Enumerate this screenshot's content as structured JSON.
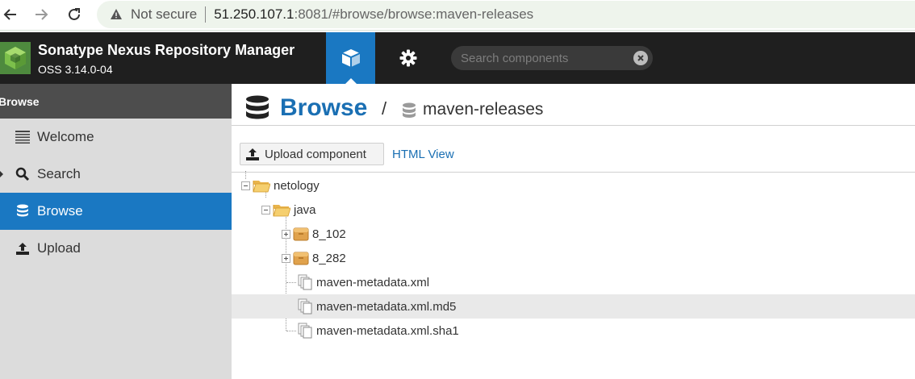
{
  "browser": {
    "security_label": "Not secure",
    "url_host": "51.250.107.1",
    "url_rest": ":8081/#browse/browse:maven-releases"
  },
  "header": {
    "app_title": "Sonatype Nexus Repository Manager",
    "version": "OSS 3.14.0-04",
    "search_placeholder": "Search components",
    "accent_color": "#1a78c2"
  },
  "sidebar": {
    "heading": "Browse",
    "items": [
      {
        "label": "Welcome",
        "icon": "list-icon"
      },
      {
        "label": "Search",
        "icon": "search-icon"
      },
      {
        "label": "Browse",
        "icon": "database-icon",
        "active": true
      },
      {
        "label": "Upload",
        "icon": "upload-icon"
      }
    ]
  },
  "main": {
    "title": "Browse",
    "separator": "/",
    "repository": "maven-releases",
    "toolbar": {
      "upload_label": "Upload component",
      "html_view_label": "HTML View"
    },
    "tree": [
      {
        "label": "netology",
        "type": "folder-open",
        "depth": 0,
        "expander": "minus"
      },
      {
        "label": "java",
        "type": "folder-open",
        "depth": 1,
        "expander": "minus"
      },
      {
        "label": "8_102",
        "type": "component",
        "depth": 2,
        "expander": "plus"
      },
      {
        "label": "8_282",
        "type": "component",
        "depth": 2,
        "expander": "plus"
      },
      {
        "label": "maven-metadata.xml",
        "type": "file",
        "depth": 2
      },
      {
        "label": "maven-metadata.xml.md5",
        "type": "file",
        "depth": 2,
        "highlighted": true
      },
      {
        "label": "maven-metadata.xml.sha1",
        "type": "file",
        "depth": 2
      }
    ]
  }
}
